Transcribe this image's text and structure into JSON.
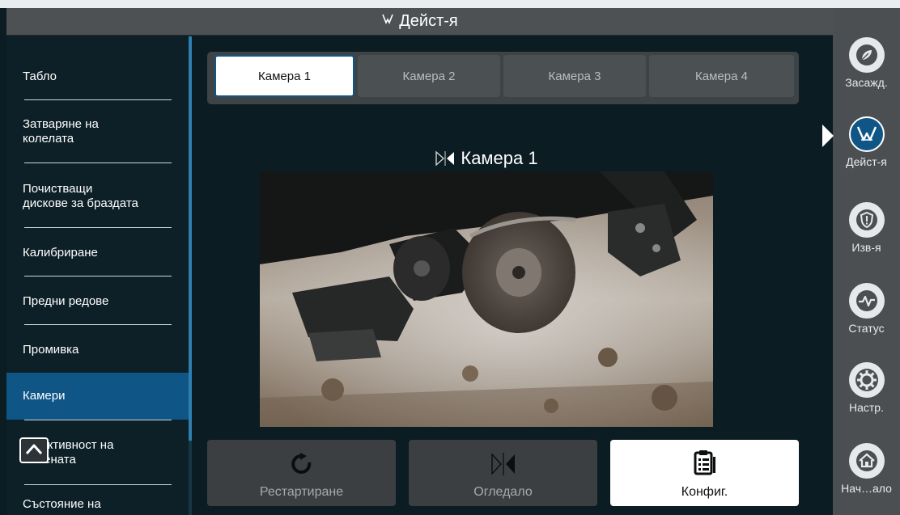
{
  "header": {
    "title": "Дейст-я",
    "icon": "action-icon"
  },
  "sidebar": {
    "items": [
      {
        "label": "Табло"
      },
      {
        "label": "Затваряне на\nколелата"
      },
      {
        "label": "Почистващи\nдискове за браздата"
      },
      {
        "label": "Калибриране"
      },
      {
        "label": "Предни редове"
      },
      {
        "label": "Промивка"
      },
      {
        "label": "Камери",
        "active": true
      },
      {
        "label": "Ефективност на\nсемената"
      },
      {
        "label": "Състояние на"
      }
    ],
    "scroll_up_icon": "chevron-up-icon"
  },
  "tabs": [
    {
      "label": "Камера 1",
      "active": true
    },
    {
      "label": "Камера 2"
    },
    {
      "label": "Камера 3"
    },
    {
      "label": "Камера 4"
    }
  ],
  "camera": {
    "title": "Камера 1",
    "mirror_icon": "mirror-icon"
  },
  "actions": {
    "restart": {
      "label": "Рестартиране",
      "icon": "restart-icon"
    },
    "mirror": {
      "label": "Огледало",
      "icon": "mirror-icon"
    },
    "config": {
      "label": "Конфиг.",
      "icon": "clipboard-icon"
    }
  },
  "rail": {
    "items": [
      {
        "label": "Засажд.",
        "icon": "seed-icon"
      },
      {
        "label": "Дейст-я",
        "icon": "action-icon",
        "active": true
      },
      {
        "label": "Изв-я",
        "icon": "alert-shield-icon"
      },
      {
        "label": "Статус",
        "icon": "pulse-icon"
      },
      {
        "label": "Настр.",
        "icon": "gear-icon"
      },
      {
        "label": "Нач…ало",
        "icon": "home-icon"
      }
    ]
  },
  "colors": {
    "accent": "#0f5687",
    "background": "#0b1c22",
    "rail": "#4b4f52"
  }
}
